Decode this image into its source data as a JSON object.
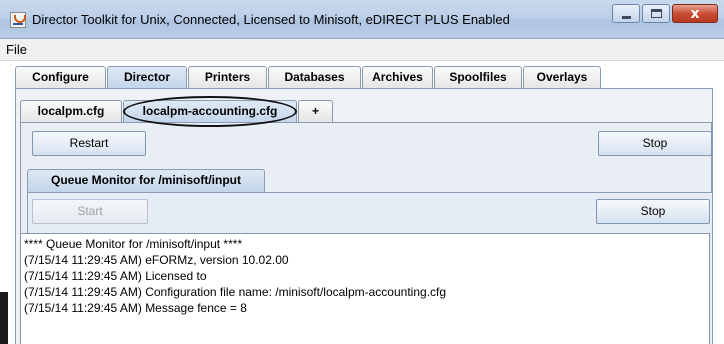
{
  "window": {
    "title": "Director Toolkit for Unix, Connected, Licensed to Minisoft, eDIRECT PLUS Enabled",
    "app_icon": "java-cup-icon",
    "controls": {
      "minimize": "minimize-icon",
      "maximize": "maximize-icon",
      "close": "x"
    }
  },
  "menubar": {
    "items": [
      "File"
    ]
  },
  "main_tabs": [
    "Configure",
    "Director",
    "Printers",
    "Databases",
    "Archives",
    "Spoolfiles",
    "Overlays"
  ],
  "main_tab_selected": "Director",
  "config_tabs": [
    "localpm.cfg",
    "localpm-accounting.cfg",
    "+"
  ],
  "config_tab_selected": "localpm-accounting.cfg",
  "director_controls": {
    "restart": "Restart",
    "stop": "Stop"
  },
  "queue_tab": {
    "label": "Queue Monitor for /minisoft/input"
  },
  "queue_controls": {
    "start": "Start",
    "start_enabled": false,
    "stop": "Stop"
  },
  "log_lines": [
    "**** Queue Monitor for /minisoft/input ****",
    " (7/15/14 11:29:45 AM) eFORMz, version 10.02.00",
    " (7/15/14 11:29:45 AM) Licensed to",
    " (7/15/14 11:29:45 AM)   Configuration file name: /minisoft/localpm-accounting.cfg",
    " (7/15/14 11:29:45 AM)   Message fence = 8"
  ],
  "colors": {
    "titlebar": "#bcd0e8",
    "close_button": "#c7492f",
    "selected_tab": "#c2d5ea",
    "annotation": "#111111"
  }
}
